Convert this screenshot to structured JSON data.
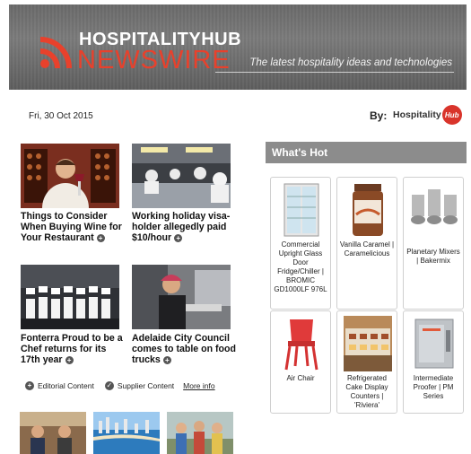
{
  "header": {
    "brand_top": "HOSPITALITYHUB",
    "brand_bottom": "NEWSWIRE",
    "tagline": "The latest hospitality ideas and technologies",
    "accent_color": "#e8412c"
  },
  "meta": {
    "date": "Fri, 30 Oct 2015",
    "by_label": "By:",
    "logo_text": "Hospitality",
    "logo_badge": "Hub"
  },
  "news": [
    {
      "title": "Things to Consider When Buying Wine for Your Restaurant",
      "icon": "plus-icon"
    },
    {
      "title": "Working holiday visa-holder allegedly paid $10/hour",
      "icon": "plus-icon"
    },
    {
      "title": "Fonterra Proud to be a Chef returns for its 17th year",
      "icon": "plus-icon"
    },
    {
      "title": "Adelaide City Council comes to table on food trucks",
      "icon": "plus-icon"
    }
  ],
  "legend": {
    "editorial": "Editorial Content",
    "supplier": "Supplier Content",
    "more": "More info"
  },
  "whats_hot": {
    "title": "What's Hot",
    "items": [
      {
        "label": "Commercial Upright Glass Door Fridge/Chiller | BROMIC GD1000LF 976L"
      },
      {
        "label": "Vanilla Caramel | Caramelicious"
      },
      {
        "label": "Planetary Mixers | Bakermix"
      },
      {
        "label": "Air Chair"
      },
      {
        "label": "Refrigerated Cake Display Counters | 'Riviera'"
      },
      {
        "label": "Intermediate Proofer | PM Series"
      }
    ]
  }
}
